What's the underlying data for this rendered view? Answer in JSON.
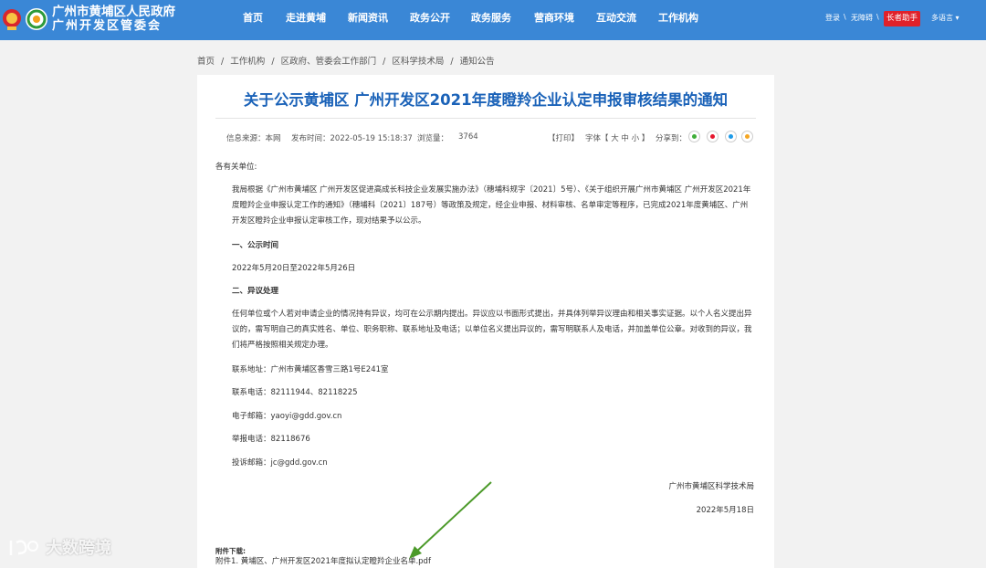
{
  "header": {
    "title_line1": "广州市黄埔区人民政府",
    "title_line2": "广州开发区管委会",
    "nav": [
      "首页",
      "走进黄埔",
      "新闻资讯",
      "政务公开",
      "政务服务",
      "营商环境",
      "互动交流",
      "工作机构"
    ],
    "login": "登录",
    "sep1": "\\",
    "accessible": "无障碍",
    "sep2": "\\",
    "elder": "长者助手",
    "language": "多语言 ▾"
  },
  "breadcrumb": {
    "items": [
      "首页",
      "工作机构",
      "区政府、管委会工作部门",
      "区科学技术局",
      "通知公告"
    ],
    "sep": "/"
  },
  "article": {
    "title": "关于公示黄埔区 广州开发区2021年度瞪羚企业认定申报审核结果的通知",
    "source": "信息来源：本网",
    "published": "发布时间：2022-05-19 15:18:37",
    "views_label": "浏览量：",
    "views": "3764",
    "print": "【打印】",
    "font_size": "字体【 大  中  小 】",
    "share": "分享到：",
    "greeting": "各有关单位:",
    "para1": "我局根据《广州市黄埔区 广州开发区促进高成长科技企业发展实施办法》（穗埔科规字〔2021〕5号）、《关于组织开展广州市黄埔区 广州开发区2021年度瞪羚企业申报认定工作的通知》（穗埔科〔2021〕187号）等政策及规定，经企业申报、材料审核、名单审定等程序，已完成2021年度黄埔区、广州开发区瞪羚企业申报认定审核工作，现对结果予以公示。",
    "h1": "一、公示时间",
    "period": "2022年5月20日至2022年5月26日",
    "h2": "二、异议处理",
    "para2": "任何单位或个人若对申请企业的情况持有异议，均可在公示期内提出。异议应以书面形式提出，并具体列举异议理由和相关事实证据。以个人名义提出异议的，需写明自己的真实姓名、单位、职务职称、联系地址及电话；以单位名义提出异议的，需写明联系人及电话，并加盖单位公章。对收到的异议，我们将严格按照相关规定办理。",
    "address": "联系地址：广州市黄埔区香雪三路1号E241室",
    "phone": "联系电话：82111944、82118225",
    "email": "电子邮箱：yaoyi@gdd.gov.cn",
    "report_phone": "举报电话：82118676",
    "complaint_email": "投诉邮箱：jc@gdd.gov.cn",
    "signature": "广州市黄埔区科学技术局",
    "date": "2022年5月18日",
    "attachment_label": "附件下载:",
    "attachment": "附件1. 黄埔区、广州开发区2021年度拟认定瞪羚企业名单.pdf"
  },
  "watermark": "大数跨境",
  "colors": {
    "header": "#3a87d6",
    "title": "#1a62b8",
    "elder": "#e0212a",
    "arrow": "#4c9a2a"
  }
}
